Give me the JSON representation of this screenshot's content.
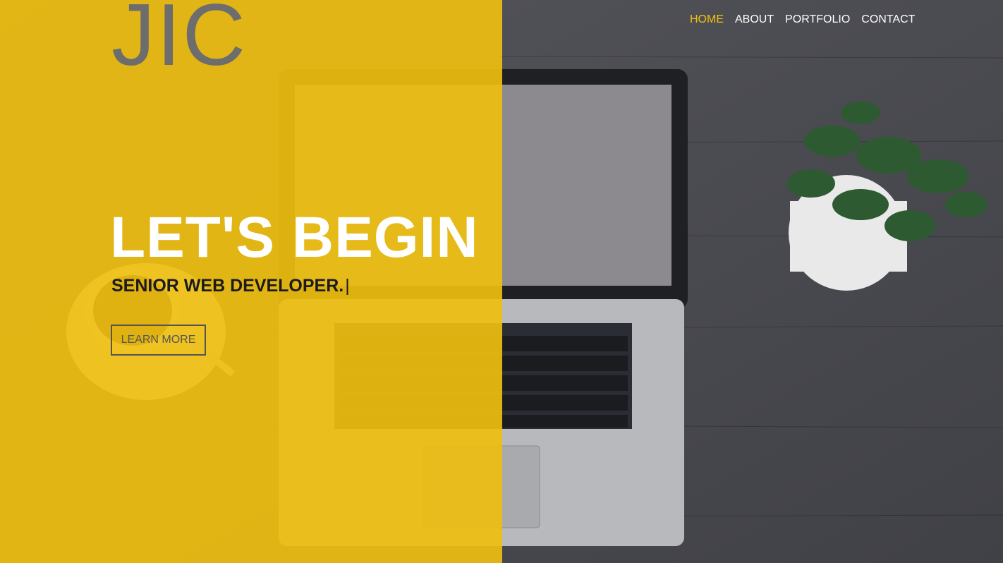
{
  "brand": {
    "logo_text": "JIC"
  },
  "nav": {
    "items": [
      {
        "label": "HOME",
        "active": true
      },
      {
        "label": "ABOUT",
        "active": false
      },
      {
        "label": "PORTFOLIO",
        "active": false
      },
      {
        "label": "CONTACT",
        "active": false
      }
    ]
  },
  "hero": {
    "headline": "LET'S BEGIN",
    "subheadline": "SENIOR WEB DEVELOPER.",
    "cursor": "|",
    "cta_label": "LEARN MORE"
  },
  "colors": {
    "accent": "#f2c10f",
    "panel": "#eebe0f",
    "logo": "#6d6d6d",
    "background": "#3f4045"
  },
  "icons": {
    "decor": [
      "laptop-image",
      "coffee-cup-image",
      "potted-plant-image"
    ]
  }
}
